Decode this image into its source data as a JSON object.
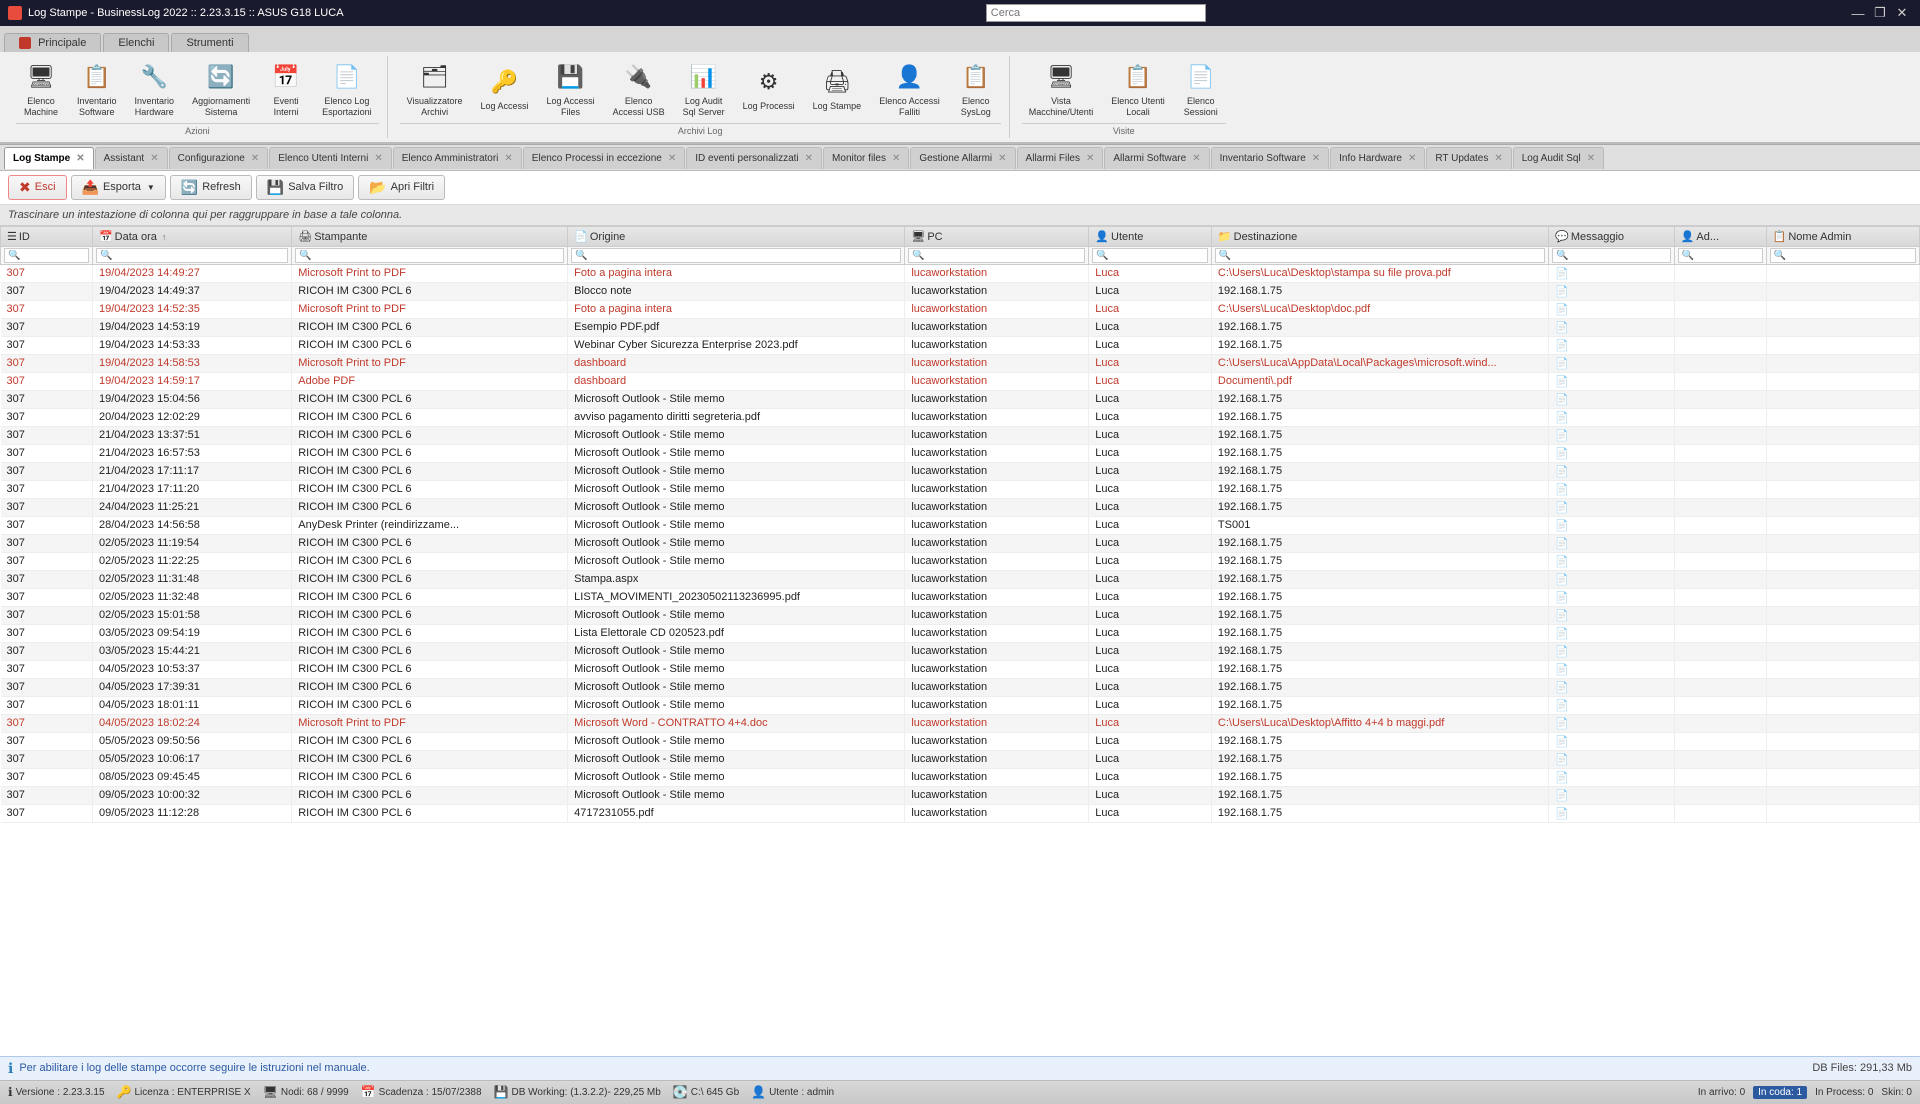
{
  "titlebar": {
    "title": "Log Stampe - BusinessLog 2022 :: 2.23.3.15 :: ASUS G18 LUCA",
    "search_placeholder": "Cerca",
    "win_controls": [
      "—",
      "❐",
      "✕"
    ]
  },
  "ribbon": {
    "tabs": [
      {
        "label": "Principale",
        "active": false,
        "icon": "principal"
      },
      {
        "label": "Elenchi",
        "active": false,
        "icon": "list"
      },
      {
        "label": "Strumenti",
        "active": false,
        "icon": "tools"
      }
    ],
    "groups": [
      {
        "label": "Azioni",
        "buttons": [
          {
            "icon": "🖥",
            "label": "Elenco\nMachine"
          },
          {
            "icon": "📋",
            "label": "Inventario\nSoftware"
          },
          {
            "icon": "🔧",
            "label": "Inventario\nHardware"
          },
          {
            "icon": "🔄",
            "label": "Aggiornamenti\nSistema"
          },
          {
            "icon": "📅",
            "label": "Eventi\nInterni"
          },
          {
            "icon": "📄",
            "label": "Elenco Log\nEsportazioni"
          }
        ]
      },
      {
        "label": "Archivi Log",
        "buttons": [
          {
            "icon": "🗂",
            "label": "Visualizzatore\nArchivi"
          },
          {
            "icon": "🔑",
            "label": "Log Accessi"
          },
          {
            "icon": "💾",
            "label": "Log Accessi\nFiles"
          },
          {
            "icon": "🔌",
            "label": "Elenco\nAccessi USB"
          },
          {
            "icon": "📊",
            "label": "Log Audit\nSql Server"
          },
          {
            "icon": "⚙",
            "label": "Log Processi"
          },
          {
            "icon": "🖨",
            "label": "Log Stampe"
          },
          {
            "icon": "👤",
            "label": "Elenco Accessi\nFalliti"
          },
          {
            "icon": "📋",
            "label": "Elenco\nSysLog"
          }
        ]
      },
      {
        "label": "Visite",
        "buttons": [
          {
            "icon": "🖥",
            "label": "Vista\nMacchine/Utenti"
          },
          {
            "icon": "📋",
            "label": "Elenco Utenti\nLocali"
          },
          {
            "icon": "📄",
            "label": "Elenco\nSessioni"
          }
        ]
      }
    ]
  },
  "page_tabs": [
    {
      "label": "Assistant",
      "active": false,
      "closable": true
    },
    {
      "label": "Configurazione",
      "active": false,
      "closable": true
    },
    {
      "label": "Elenco Utenti Interni",
      "active": false,
      "closable": true
    },
    {
      "label": "Elenco Amministratori",
      "active": false,
      "closable": true
    },
    {
      "label": "Elenco Processi in eccezione",
      "active": false,
      "closable": true
    },
    {
      "label": "ID eventi personalizzati",
      "active": false,
      "closable": true
    },
    {
      "label": "Monitor files",
      "active": false,
      "closable": true
    },
    {
      "label": "Gestione Allarmi",
      "active": false,
      "closable": true
    },
    {
      "label": "Allarmi Files",
      "active": false,
      "closable": true
    },
    {
      "label": "Allarmi Software",
      "active": false,
      "closable": true
    },
    {
      "label": "Inventario Software",
      "active": false,
      "closable": true
    },
    {
      "label": "Info Hardware",
      "active": false,
      "closable": true
    },
    {
      "label": "RT Updates",
      "active": false,
      "closable": true
    },
    {
      "label": "Log Audit Sql",
      "active": false,
      "closable": true
    },
    {
      "label": "Log Stampe",
      "active": true,
      "closable": true
    }
  ],
  "toolbar": {
    "exit_label": "Esci",
    "export_label": "Esporta",
    "refresh_label": "Refresh",
    "save_filter_label": "Salva Filtro",
    "open_filters_label": "Apri Filtri"
  },
  "group_header": {
    "text": "Trascinare un intestazione di colonna qui per raggruppare in base a tale colonna."
  },
  "table": {
    "columns": [
      {
        "id": "id",
        "label": "ID",
        "icon": "☰"
      },
      {
        "id": "data_ora",
        "label": "Data ora",
        "icon": "📅",
        "sort": "↑"
      },
      {
        "id": "stampante",
        "label": "Stampante",
        "icon": "🖨"
      },
      {
        "id": "origine",
        "label": "Origine",
        "icon": "📄"
      },
      {
        "id": "pc",
        "label": "PC",
        "icon": "🖥"
      },
      {
        "id": "utente",
        "label": "Utente",
        "icon": "👤"
      },
      {
        "id": "destinazione",
        "label": "Destinazione",
        "icon": "📁"
      },
      {
        "id": "messaggio",
        "label": "Messaggio",
        "icon": "💬"
      },
      {
        "id": "ad",
        "label": "Ad...",
        "icon": "👤"
      },
      {
        "id": "nome_admin",
        "label": "Nome Admin",
        "icon": "📋"
      }
    ],
    "rows": [
      {
        "id": "307",
        "data_ora": "19/04/2023 14:49:27",
        "stampante": "Microsoft Print to PDF",
        "origine": "Foto a pagina intera",
        "pc": "lucaworkstation",
        "utente": "Luca",
        "destinazione": "C:\\Users\\Luca\\Desktop\\stampa su file prova.pdf",
        "messaggio": "",
        "ad": "",
        "nome_admin": "",
        "red": true
      },
      {
        "id": "307",
        "data_ora": "19/04/2023 14:49:37",
        "stampante": "RICOH IM C300 PCL 6",
        "origine": "Blocco note",
        "pc": "lucaworkstation",
        "utente": "Luca",
        "destinazione": "192.168.1.75",
        "messaggio": "",
        "ad": "",
        "nome_admin": "",
        "red": false
      },
      {
        "id": "307",
        "data_ora": "19/04/2023 14:52:35",
        "stampante": "Microsoft Print to PDF",
        "origine": "Foto a pagina intera",
        "pc": "lucaworkstation",
        "utente": "Luca",
        "destinazione": "C:\\Users\\Luca\\Desktop\\doc.pdf",
        "messaggio": "",
        "ad": "",
        "nome_admin": "",
        "red": true
      },
      {
        "id": "307",
        "data_ora": "19/04/2023 14:53:19",
        "stampante": "RICOH IM C300 PCL 6",
        "origine": "Esempio PDF.pdf",
        "pc": "lucaworkstation",
        "utente": "Luca",
        "destinazione": "192.168.1.75",
        "messaggio": "",
        "ad": "",
        "nome_admin": "",
        "red": false
      },
      {
        "id": "307",
        "data_ora": "19/04/2023 14:53:33",
        "stampante": "RICOH IM C300 PCL 6",
        "origine": "Webinar Cyber Sicurezza Enterprise 2023.pdf",
        "pc": "lucaworkstation",
        "utente": "Luca",
        "destinazione": "192.168.1.75",
        "messaggio": "",
        "ad": "",
        "nome_admin": "",
        "red": false
      },
      {
        "id": "307",
        "data_ora": "19/04/2023 14:58:53",
        "stampante": "Microsoft Print to PDF",
        "origine": "dashboard",
        "pc": "lucaworkstation",
        "utente": "Luca",
        "destinazione": "C:\\Users\\Luca\\AppData\\Local\\Packages\\microsoft.wind...",
        "messaggio": "",
        "ad": "",
        "nome_admin": "",
        "red": true
      },
      {
        "id": "307",
        "data_ora": "19/04/2023 14:59:17",
        "stampante": "Adobe PDF",
        "origine": "dashboard",
        "pc": "lucaworkstation",
        "utente": "Luca",
        "destinazione": "Documenti\\.pdf",
        "messaggio": "",
        "ad": "",
        "nome_admin": "",
        "red": true
      },
      {
        "id": "307",
        "data_ora": "19/04/2023 15:04:56",
        "stampante": "RICOH IM C300 PCL 6",
        "origine": "Microsoft Outlook - Stile memo",
        "pc": "lucaworkstation",
        "utente": "Luca",
        "destinazione": "192.168.1.75",
        "messaggio": "",
        "ad": "",
        "nome_admin": "",
        "red": false
      },
      {
        "id": "307",
        "data_ora": "20/04/2023 12:02:29",
        "stampante": "RICOH IM C300 PCL 6",
        "origine": "avviso pagamento diritti segreteria.pdf",
        "pc": "lucaworkstation",
        "utente": "Luca",
        "destinazione": "192.168.1.75",
        "messaggio": "",
        "ad": "",
        "nome_admin": "",
        "red": false
      },
      {
        "id": "307",
        "data_ora": "21/04/2023 13:37:51",
        "stampante": "RICOH IM C300 PCL 6",
        "origine": "Microsoft Outlook - Stile memo",
        "pc": "lucaworkstation",
        "utente": "Luca",
        "destinazione": "192.168.1.75",
        "messaggio": "",
        "ad": "",
        "nome_admin": "",
        "red": false
      },
      {
        "id": "307",
        "data_ora": "21/04/2023 16:57:53",
        "stampante": "RICOH IM C300 PCL 6",
        "origine": "Microsoft Outlook - Stile memo",
        "pc": "lucaworkstation",
        "utente": "Luca",
        "destinazione": "192.168.1.75",
        "messaggio": "",
        "ad": "",
        "nome_admin": "",
        "red": false
      },
      {
        "id": "307",
        "data_ora": "21/04/2023 17:11:17",
        "stampante": "RICOH IM C300 PCL 6",
        "origine": "Microsoft Outlook - Stile memo",
        "pc": "lucaworkstation",
        "utente": "Luca",
        "destinazione": "192.168.1.75",
        "messaggio": "",
        "ad": "",
        "nome_admin": "",
        "red": false
      },
      {
        "id": "307",
        "data_ora": "21/04/2023 17:11:20",
        "stampante": "RICOH IM C300 PCL 6",
        "origine": "Microsoft Outlook - Stile memo",
        "pc": "lucaworkstation",
        "utente": "Luca",
        "destinazione": "192.168.1.75",
        "messaggio": "",
        "ad": "",
        "nome_admin": "",
        "red": false
      },
      {
        "id": "307",
        "data_ora": "24/04/2023 11:25:21",
        "stampante": "RICOH IM C300 PCL 6",
        "origine": "Microsoft Outlook - Stile memo",
        "pc": "lucaworkstation",
        "utente": "Luca",
        "destinazione": "192.168.1.75",
        "messaggio": "",
        "ad": "",
        "nome_admin": "",
        "red": false
      },
      {
        "id": "307",
        "data_ora": "28/04/2023 14:56:58",
        "stampante": "AnyDesk Printer (reindirizzame...",
        "origine": "Microsoft Outlook - Stile memo",
        "pc": "lucaworkstation",
        "utente": "Luca",
        "destinazione": "TS001",
        "messaggio": "",
        "ad": "",
        "nome_admin": "",
        "red": false
      },
      {
        "id": "307",
        "data_ora": "02/05/2023 11:19:54",
        "stampante": "RICOH IM C300 PCL 6",
        "origine": "Microsoft Outlook - Stile memo",
        "pc": "lucaworkstation",
        "utente": "Luca",
        "destinazione": "192.168.1.75",
        "messaggio": "",
        "ad": "",
        "nome_admin": "",
        "red": false
      },
      {
        "id": "307",
        "data_ora": "02/05/2023 11:22:25",
        "stampante": "RICOH IM C300 PCL 6",
        "origine": "Microsoft Outlook - Stile memo",
        "pc": "lucaworkstation",
        "utente": "Luca",
        "destinazione": "192.168.1.75",
        "messaggio": "",
        "ad": "",
        "nome_admin": "",
        "red": false
      },
      {
        "id": "307",
        "data_ora": "02/05/2023 11:31:48",
        "stampante": "RICOH IM C300 PCL 6",
        "origine": "Stampa.aspx",
        "pc": "lucaworkstation",
        "utente": "Luca",
        "destinazione": "192.168.1.75",
        "messaggio": "",
        "ad": "",
        "nome_admin": "",
        "red": false
      },
      {
        "id": "307",
        "data_ora": "02/05/2023 11:32:48",
        "stampante": "RICOH IM C300 PCL 6",
        "origine": "LISTA_MOVIMENTI_20230502113236995.pdf",
        "pc": "lucaworkstation",
        "utente": "Luca",
        "destinazione": "192.168.1.75",
        "messaggio": "",
        "ad": "",
        "nome_admin": "",
        "red": false
      },
      {
        "id": "307",
        "data_ora": "02/05/2023 15:01:58",
        "stampante": "RICOH IM C300 PCL 6",
        "origine": "Microsoft Outlook - Stile memo",
        "pc": "lucaworkstation",
        "utente": "Luca",
        "destinazione": "192.168.1.75",
        "messaggio": "",
        "ad": "",
        "nome_admin": "",
        "red": false
      },
      {
        "id": "307",
        "data_ora": "03/05/2023 09:54:19",
        "stampante": "RICOH IM C300 PCL 6",
        "origine": "Lista Elettorale CD 020523.pdf",
        "pc": "lucaworkstation",
        "utente": "Luca",
        "destinazione": "192.168.1.75",
        "messaggio": "",
        "ad": "",
        "nome_admin": "",
        "red": false
      },
      {
        "id": "307",
        "data_ora": "03/05/2023 15:44:21",
        "stampante": "RICOH IM C300 PCL 6",
        "origine": "Microsoft Outlook - Stile memo",
        "pc": "lucaworkstation",
        "utente": "Luca",
        "destinazione": "192.168.1.75",
        "messaggio": "",
        "ad": "",
        "nome_admin": "",
        "red": false
      },
      {
        "id": "307",
        "data_ora": "04/05/2023 10:53:37",
        "stampante": "RICOH IM C300 PCL 6",
        "origine": "Microsoft Outlook - Stile memo",
        "pc": "lucaworkstation",
        "utente": "Luca",
        "destinazione": "192.168.1.75",
        "messaggio": "",
        "ad": "",
        "nome_admin": "",
        "red": false
      },
      {
        "id": "307",
        "data_ora": "04/05/2023 17:39:31",
        "stampante": "RICOH IM C300 PCL 6",
        "origine": "Microsoft Outlook - Stile memo",
        "pc": "lucaworkstation",
        "utente": "Luca",
        "destinazione": "192.168.1.75",
        "messaggio": "",
        "ad": "",
        "nome_admin": "",
        "red": false
      },
      {
        "id": "307",
        "data_ora": "04/05/2023 18:01:11",
        "stampante": "RICOH IM C300 PCL 6",
        "origine": "Microsoft Outlook - Stile memo",
        "pc": "lucaworkstation",
        "utente": "Luca",
        "destinazione": "192.168.1.75",
        "messaggio": "",
        "ad": "",
        "nome_admin": "",
        "red": false
      },
      {
        "id": "307",
        "data_ora": "04/05/2023 18:02:24",
        "stampante": "Microsoft Print to PDF",
        "origine": "Microsoft Word - CONTRATTO 4+4.doc",
        "pc": "lucaworkstation",
        "utente": "Luca",
        "destinazione": "C:\\Users\\Luca\\Desktop\\Affitto 4+4 b maggi.pdf",
        "messaggio": "",
        "ad": "",
        "nome_admin": "",
        "red": true
      },
      {
        "id": "307",
        "data_ora": "05/05/2023 09:50:56",
        "stampante": "RICOH IM C300 PCL 6",
        "origine": "Microsoft Outlook - Stile memo",
        "pc": "lucaworkstation",
        "utente": "Luca",
        "destinazione": "192.168.1.75",
        "messaggio": "",
        "ad": "",
        "nome_admin": "",
        "red": false
      },
      {
        "id": "307",
        "data_ora": "05/05/2023 10:06:17",
        "stampante": "RICOH IM C300 PCL 6",
        "origine": "Microsoft Outlook - Stile memo",
        "pc": "lucaworkstation",
        "utente": "Luca",
        "destinazione": "192.168.1.75",
        "messaggio": "",
        "ad": "",
        "nome_admin": "",
        "red": false
      },
      {
        "id": "307",
        "data_ora": "08/05/2023 09:45:45",
        "stampante": "RICOH IM C300 PCL 6",
        "origine": "Microsoft Outlook - Stile memo",
        "pc": "lucaworkstation",
        "utente": "Luca",
        "destinazione": "192.168.1.75",
        "messaggio": "",
        "ad": "",
        "nome_admin": "",
        "red": false
      },
      {
        "id": "307",
        "data_ora": "09/05/2023 10:00:32",
        "stampante": "RICOH IM C300 PCL 6",
        "origine": "Microsoft Outlook - Stile memo",
        "pc": "lucaworkstation",
        "utente": "Luca",
        "destinazione": "192.168.1.75",
        "messaggio": "",
        "ad": "",
        "nome_admin": "",
        "red": false
      },
      {
        "id": "307",
        "data_ora": "09/05/2023 11:12:28",
        "stampante": "RICOH IM C300 PCL 6",
        "origine": "4717231055.pdf",
        "pc": "lucaworkstation",
        "utente": "Luca",
        "destinazione": "192.168.1.75",
        "messaggio": "",
        "ad": "",
        "nome_admin": "",
        "red": false
      }
    ]
  },
  "infobar": {
    "text": "Per abilitare i log delle stampe occorre seguire le istruzioni nel manuale.",
    "db_files": "DB Files: 291,33 Mb"
  },
  "statusbar": {
    "version": "Versione : 2.23.3.15",
    "license": "Licenza : ENTERPRISE X",
    "nodes": "Nodi: 68 / 9999",
    "scadenza": "Scadenza : 15/07/2388",
    "db_working": "DB Working: (1.3.2.2)- 229,25 Mb",
    "disk": "C:\\ 645 Gb",
    "user": "Utente : admin",
    "in_arrivo": "In arrivo: 0",
    "in_coda": "In coda: 1",
    "in_process": "In Process: 0",
    "skin": "Skin: 0"
  }
}
